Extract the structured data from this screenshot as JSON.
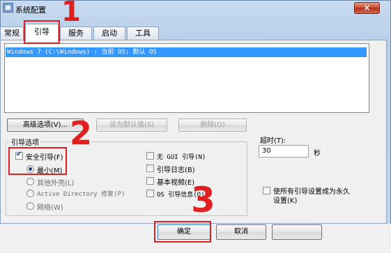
{
  "window": {
    "title": "系统配置",
    "close_glyph": "×"
  },
  "tabs": [
    {
      "label": "常规"
    },
    {
      "label": "引导"
    },
    {
      "label": "服务"
    },
    {
      "label": "启动"
    },
    {
      "label": "工具"
    }
  ],
  "os_list": {
    "rows": [
      "Windows 7 (C:\\Windows) : 当前 OS; 默认 OS"
    ]
  },
  "list_buttons": {
    "advanced": "高级选项(V)...",
    "set_default": "设为默认值(S)",
    "delete": "删除(D)"
  },
  "boot_options": {
    "legend": "引导选项",
    "safe_boot": "安全引导(F)",
    "minimal": "最小(M)",
    "alternate_shell": "其他外壳(L)",
    "active_directory": "Active Directory 修复(P)",
    "network": "网络(W)",
    "no_gui": "无 GUI 引导(N)",
    "boot_log": "引导日志(B)",
    "base_video": "基本视频(E)",
    "os_boot_info": "OS 引导信息(O)"
  },
  "timeout": {
    "label": "超时(T):",
    "value": "30",
    "unit": "秒"
  },
  "permanent": {
    "label_line1": "使所有引导设置成为永久",
    "label_line2": "设置(K)"
  },
  "footer": {
    "ok": "确定",
    "cancel": "取消"
  },
  "annotations": {
    "one": "1",
    "two": "2",
    "three": "3"
  }
}
